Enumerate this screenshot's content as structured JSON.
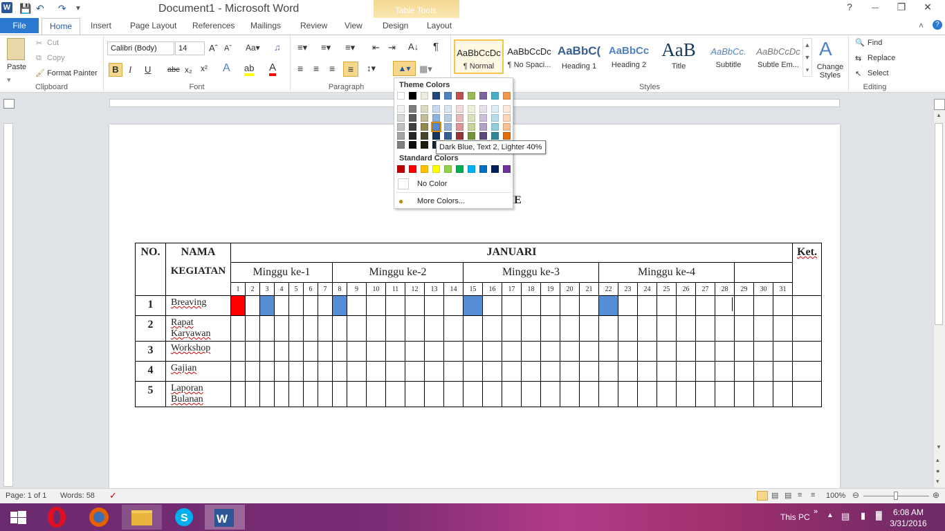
{
  "window": {
    "title": "Document1  -  Microsoft Word",
    "context_tab": "Table Tools"
  },
  "tabs": [
    "File",
    "Home",
    "Insert",
    "Page Layout",
    "References",
    "Mailings",
    "Review",
    "View",
    "Design",
    "Layout"
  ],
  "ribbon": {
    "clipboard": {
      "paste": "Paste",
      "cut": "Cut",
      "copy": "Copy",
      "format_painter": "Format Painter",
      "label": "Clipboard"
    },
    "font": {
      "name": "Calibri (Body)",
      "size": "14",
      "label": "Font"
    },
    "paragraph": {
      "label": "Paragraph"
    },
    "styles": {
      "items": [
        {
          "preview": "AaBbCcDc",
          "name": "¶ Normal"
        },
        {
          "preview": "AaBbCcDc",
          "name": "¶ No Spaci..."
        },
        {
          "preview": "AaBbC(",
          "name": "Heading 1"
        },
        {
          "preview": "AaBbCc",
          "name": "Heading 2"
        },
        {
          "preview": "AaB",
          "name": "Title"
        },
        {
          "preview": "AaBbCc.",
          "name": "Subtitle"
        },
        {
          "preview": "AaBbCcDc",
          "name": "Subtle Em..."
        }
      ],
      "change": "Change Styles",
      "label": "Styles"
    },
    "editing": {
      "find": "Find",
      "replace": "Replace",
      "select": "Select",
      "label": "Editing"
    }
  },
  "shading_dropdown": {
    "theme_label": "Theme Colors",
    "standard_label": "Standard Colors",
    "no_color": "No Color",
    "more_colors": "More Colors...",
    "tooltip": "Dark Blue, Text 2, Lighter 40%",
    "theme_top": [
      "#ffffff",
      "#000000",
      "#eeece1",
      "#1f497d",
      "#4f81bd",
      "#c0504d",
      "#9bbb59",
      "#8064a2",
      "#4bacc6",
      "#f79646"
    ],
    "theme_shades": [
      [
        "#f2f2f2",
        "#7f7f7f",
        "#ddd9c3",
        "#c6d9f0",
        "#dbe5f1",
        "#f2dcdb",
        "#ebf1dd",
        "#e5e0ec",
        "#dbeef3",
        "#fdeada"
      ],
      [
        "#d8d8d8",
        "#595959",
        "#c4bd97",
        "#8db3e2",
        "#b8cce4",
        "#e5b9b7",
        "#d7e3bc",
        "#ccc1d9",
        "#b7dde8",
        "#fbd5b5"
      ],
      [
        "#bfbfbf",
        "#3f3f3f",
        "#938953",
        "#548dd4",
        "#95b3d7",
        "#d99694",
        "#c3d69b",
        "#b2a2c7",
        "#92cddc",
        "#fac08f"
      ],
      [
        "#a5a5a5",
        "#262626",
        "#494429",
        "#17365d",
        "#366092",
        "#953734",
        "#76923c",
        "#5f497a",
        "#31859b",
        "#e36c09"
      ],
      [
        "#7f7f7f",
        "#0c0c0c",
        "#1d1b10",
        "#0f243e",
        "#244061",
        "#632423",
        "#4f6128",
        "#3f3151",
        "#205867",
        "#974806"
      ]
    ],
    "standard": [
      "#c00000",
      "#ff0000",
      "#ffc000",
      "#ffff00",
      "#92d050",
      "#00b050",
      "#00b0f0",
      "#0070c0",
      "#002060",
      "#7030a0"
    ]
  },
  "document": {
    "title_fragment": "ME",
    "table": {
      "h_no": "NO.",
      "h_nama": "NAMA",
      "h_kegiatan": "KEGIATAN",
      "h_month": "JANUARI",
      "h_ket": "Ket.",
      "weeks": [
        "Minggu ke-1",
        "Minggu ke-2",
        "Minggu ke-3",
        "Minggu ke-4",
        ""
      ],
      "days": [
        "1",
        "2",
        "3",
        "4",
        "5",
        "6",
        "7",
        "8",
        "9",
        "10",
        "11",
        "12",
        "13",
        "14",
        "15",
        "16",
        "17",
        "18",
        "19",
        "20",
        "21",
        "22",
        "23",
        "24",
        "25",
        "26",
        "27",
        "28",
        "29",
        "30",
        "31"
      ],
      "rows": [
        {
          "no": "1",
          "name": "Breaving"
        },
        {
          "no": "2",
          "name": "Rapat Karyawan"
        },
        {
          "no": "3",
          "name": "Workshop"
        },
        {
          "no": "4",
          "name": "Gajian"
        },
        {
          "no": "5",
          "name": "Laporan Bulanan"
        }
      ],
      "row1_shading": {
        "red": [
          "1"
        ],
        "blue": [
          "3",
          "8",
          "15",
          "22"
        ]
      }
    }
  },
  "statusbar": {
    "page": "Page: 1 of 1",
    "words": "Words: 58",
    "zoom": "100%"
  },
  "taskbar": {
    "this_pc": "This PC",
    "time": "6:08 AM",
    "date": "3/31/2016"
  }
}
